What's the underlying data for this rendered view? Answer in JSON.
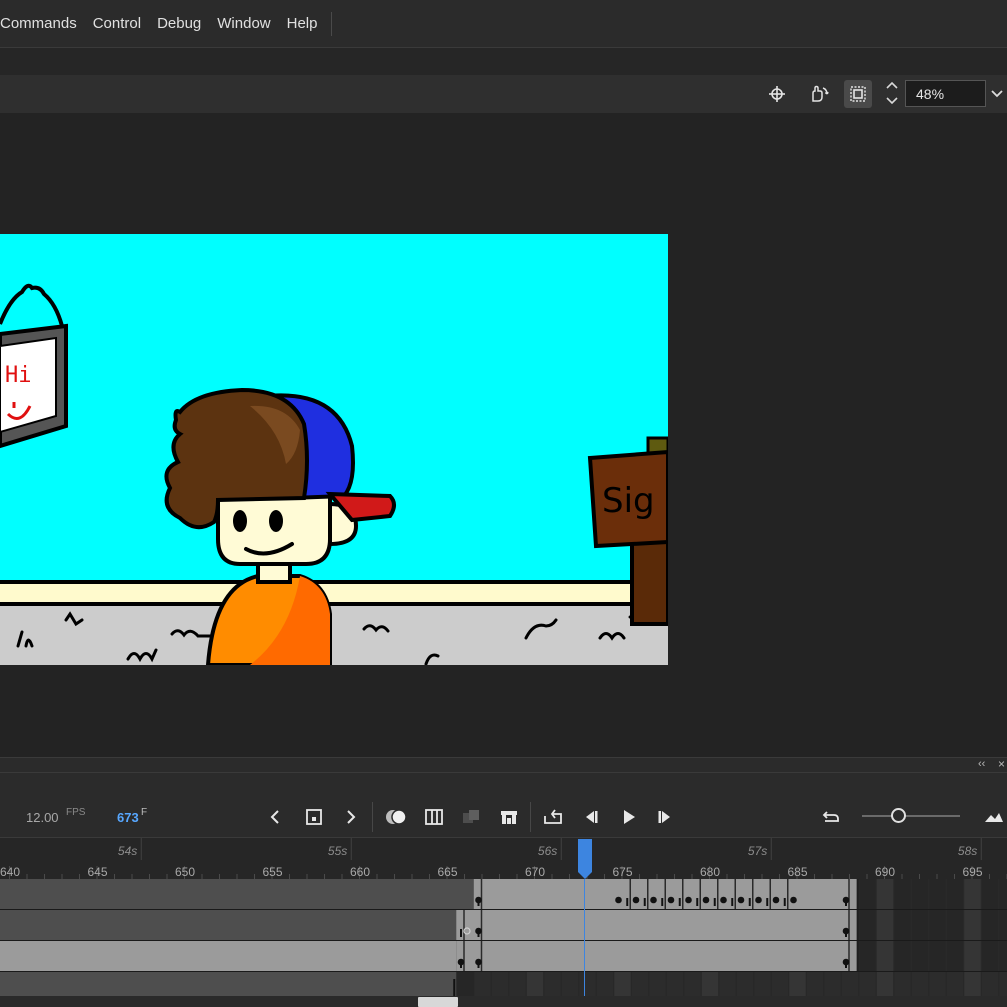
{
  "menu": [
    "Commands",
    "Control",
    "Debug",
    "Window",
    "Help"
  ],
  "stage_toolbar": {
    "icons": [
      "center-stage-icon",
      "rotate-hand-icon",
      "clip-stage-icon"
    ],
    "zoom_value": "48%"
  },
  "artwork": {
    "sign_left_text": "Hi",
    "sign_right_text": "Sig",
    "colors": {
      "sky": "#00ffff",
      "sidewalk": "#fffacd",
      "ground": "#cccccc",
      "hair": "#5c3310",
      "cap": "#1f2fe0",
      "cap_brim": "#d11919",
      "shirt": "#ff8c00",
      "skin": "#fffbd6",
      "sign_wood": "#6b2e0a"
    }
  },
  "timeline": {
    "fps_value": "12.00",
    "fps_label": "FPS",
    "frame_value": "673",
    "frame_label": "F",
    "seconds": [
      "54s",
      "55s",
      "56s",
      "57s",
      "58s"
    ],
    "frames": [
      "640",
      "645",
      "650",
      "655",
      "660",
      "665",
      "670",
      "675",
      "680",
      "685",
      "690",
      "695"
    ],
    "current_frame": 673,
    "colors": {
      "playhead": "#3d85e0",
      "frame_value": "#57a7ff"
    }
  }
}
